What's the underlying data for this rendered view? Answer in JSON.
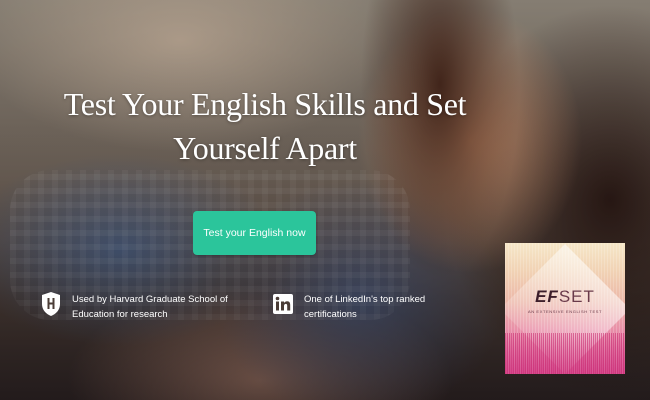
{
  "hero": {
    "headline_line1": "Test Your English Skills and Set",
    "headline_line2": "Yourself Apart",
    "cta_label": "Test your English now"
  },
  "features": [
    {
      "icon": "harvard-shield-icon",
      "line1": "Used by Harvard Graduate School of",
      "line2": "Education for research"
    },
    {
      "icon": "linkedin-icon",
      "line1": "One of LinkedIn's top ranked",
      "line2": "certifications"
    }
  ],
  "badge": {
    "logo_bold": "EF",
    "logo_light": "SET",
    "tagline": "AN EXTENSIVE ENGLISH TEST"
  },
  "colors": {
    "cta": "#2bc59b",
    "text": "#ffffff"
  }
}
